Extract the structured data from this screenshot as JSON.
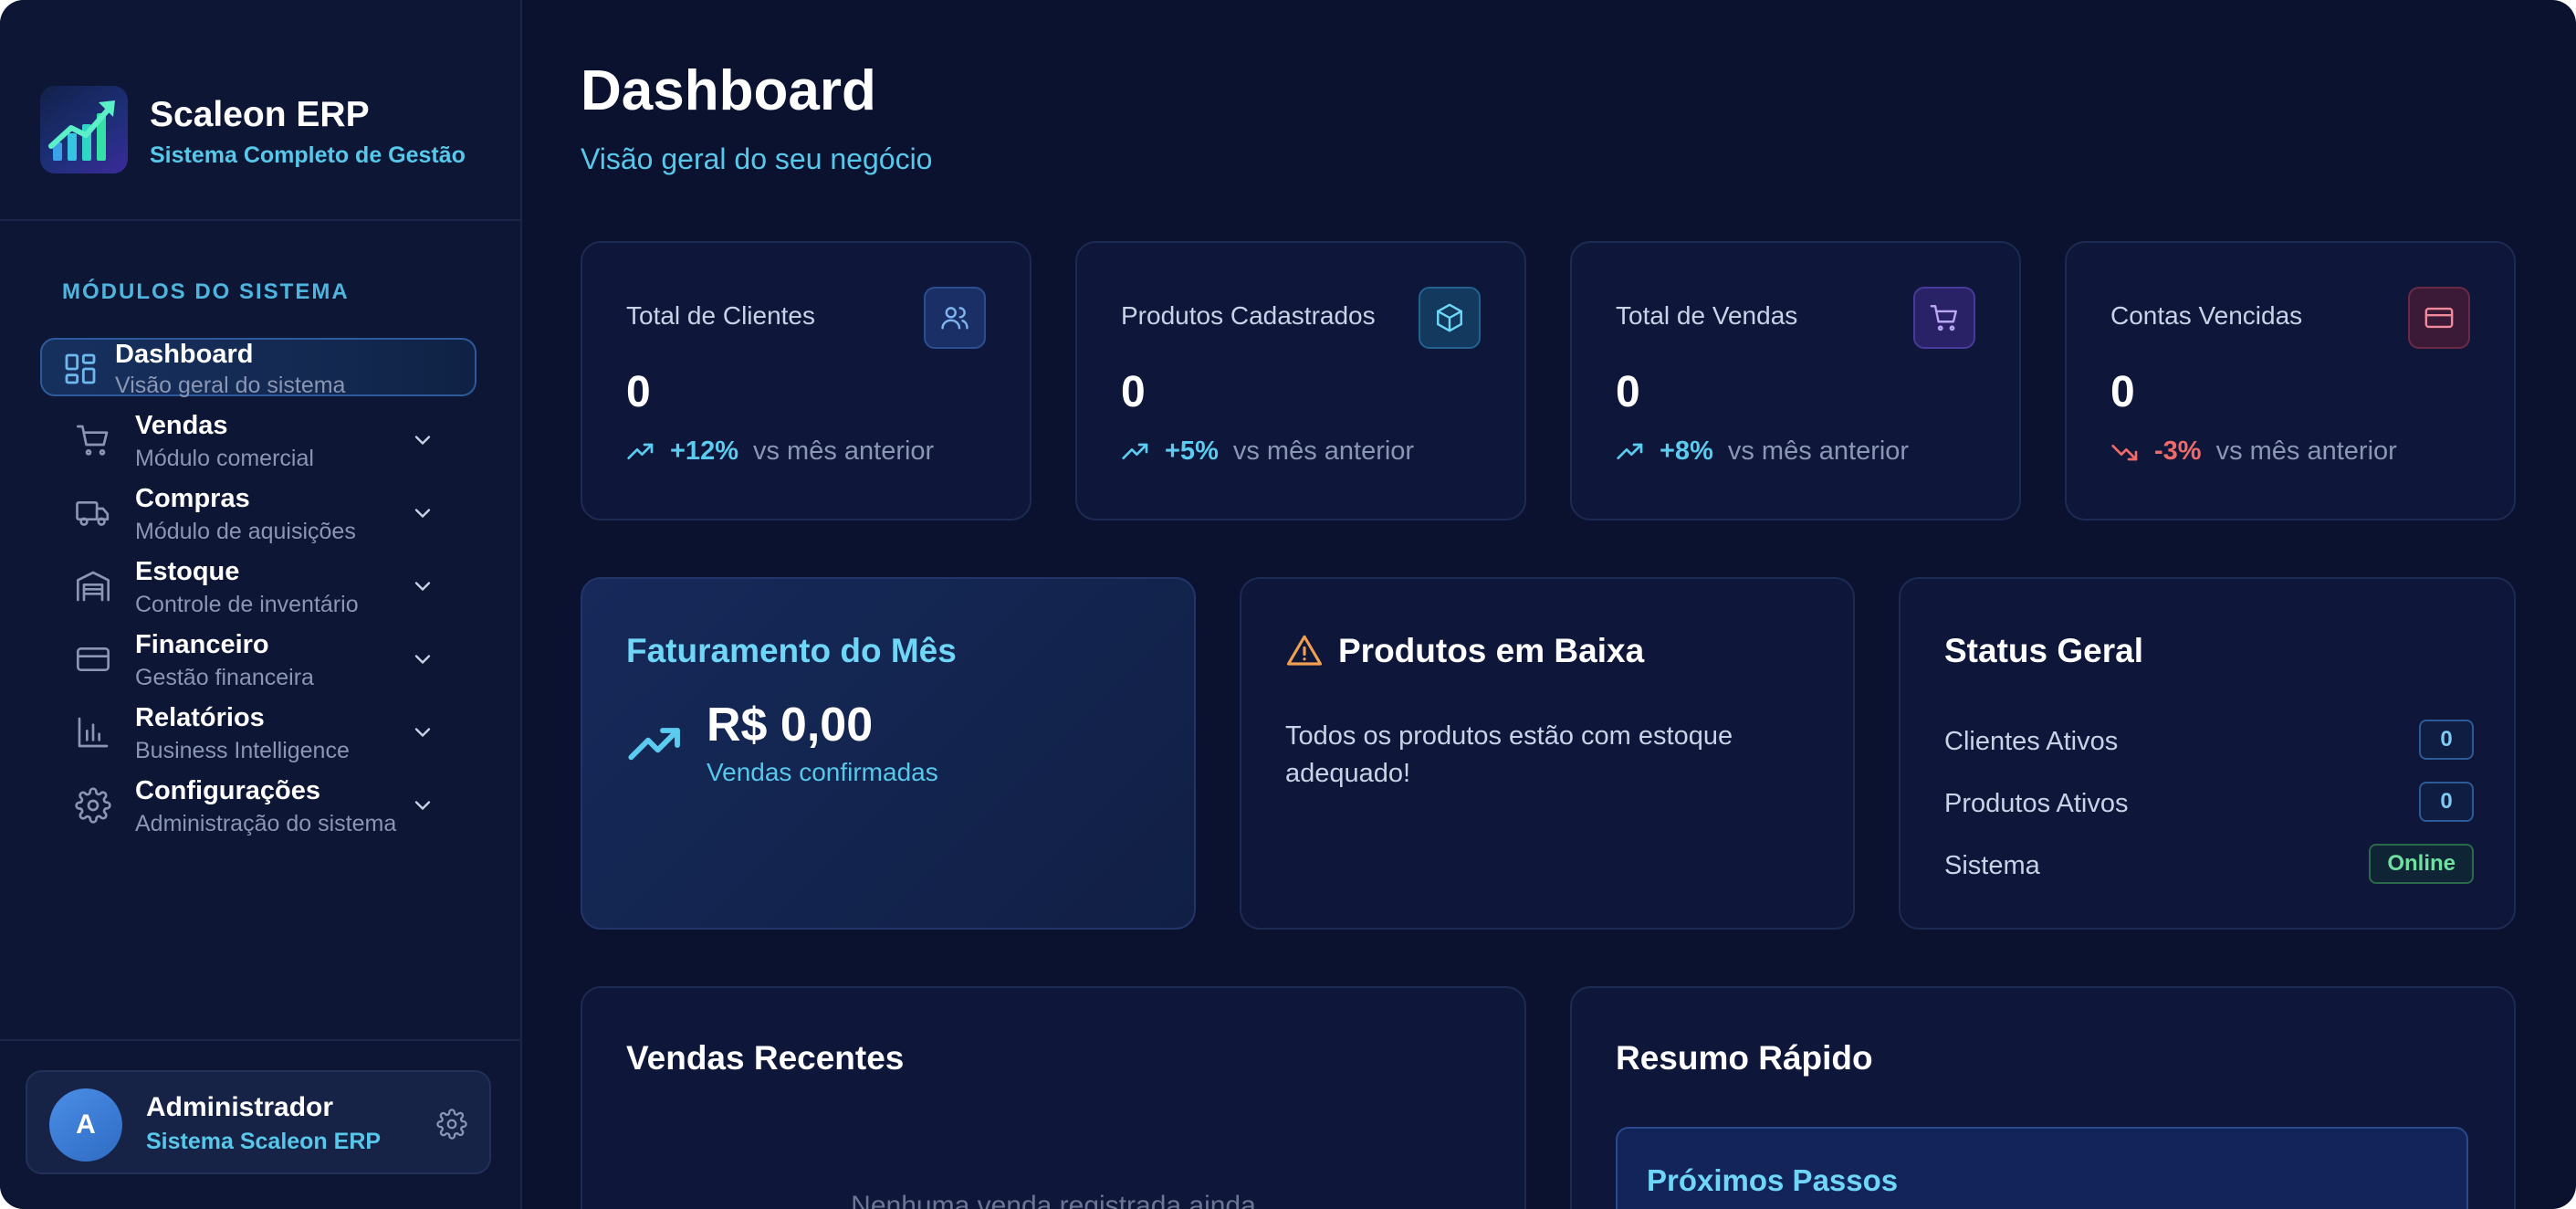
{
  "app": {
    "name": "Scaleon ERP",
    "tagline": "Sistema Completo de Gestão"
  },
  "sidebar": {
    "section_label": "MÓDULOS DO SISTEMA",
    "items": [
      {
        "title": "Dashboard",
        "subtitle": "Visão geral do sistema",
        "icon": "dashboard-grid-icon",
        "active": true
      },
      {
        "title": "Vendas",
        "subtitle": "Módulo comercial",
        "icon": "cart-icon"
      },
      {
        "title": "Compras",
        "subtitle": "Módulo de aquisições",
        "icon": "truck-icon"
      },
      {
        "title": "Estoque",
        "subtitle": "Controle de inventário",
        "icon": "warehouse-icon"
      },
      {
        "title": "Financeiro",
        "subtitle": "Gestão financeira",
        "icon": "credit-card-icon"
      },
      {
        "title": "Relatórios",
        "subtitle": "Business Intelligence",
        "icon": "bar-chart-icon"
      },
      {
        "title": "Configurações",
        "subtitle": "Administração do sistema",
        "icon": "gear-icon"
      }
    ],
    "user": {
      "initial": "A",
      "name": "Administrador",
      "role": "Sistema Scaleon ERP"
    }
  },
  "header": {
    "title": "Dashboard",
    "subtitle": "Visão geral do seu negócio"
  },
  "stats": [
    {
      "label": "Total de Clientes",
      "value": "0",
      "trend": "+12%",
      "trend_note": "vs mês anterior",
      "direction": "up",
      "icon": "users-icon",
      "color": "#5ccbf0"
    },
    {
      "label": "Produtos Cadastrados",
      "value": "0",
      "trend": "+5%",
      "trend_note": "vs mês anterior",
      "direction": "up",
      "icon": "package-icon",
      "color": "#5ccbf0"
    },
    {
      "label": "Total de Vendas",
      "value": "0",
      "trend": "+8%",
      "trend_note": "vs mês anterior",
      "direction": "up",
      "icon": "cart-icon",
      "color": "#5ccbf0"
    },
    {
      "label": "Contas Vencidas",
      "value": "0",
      "trend": "-3%",
      "trend_note": "vs mês anterior",
      "direction": "down",
      "icon": "credit-card-icon",
      "color": "#f06a6a"
    }
  ],
  "revenue": {
    "title": "Faturamento do Mês",
    "value": "R$ 0,00",
    "subtitle": "Vendas confirmadas"
  },
  "low_stock": {
    "title": "Produtos em Baixa",
    "message": "Todos os produtos estão com estoque adequado!"
  },
  "status": {
    "title": "Status Geral",
    "rows": [
      {
        "label": "Clientes Ativos",
        "value": "0"
      },
      {
        "label": "Produtos Ativos",
        "value": "0"
      },
      {
        "label": "Sistema",
        "value": "Online"
      }
    ]
  },
  "recent_sales": {
    "title": "Vendas Recentes",
    "empty": "Nenhuma venda registrada ainda"
  },
  "quick_summary": {
    "title": "Resumo Rápido",
    "next_steps_title": "Próximos Passos"
  }
}
